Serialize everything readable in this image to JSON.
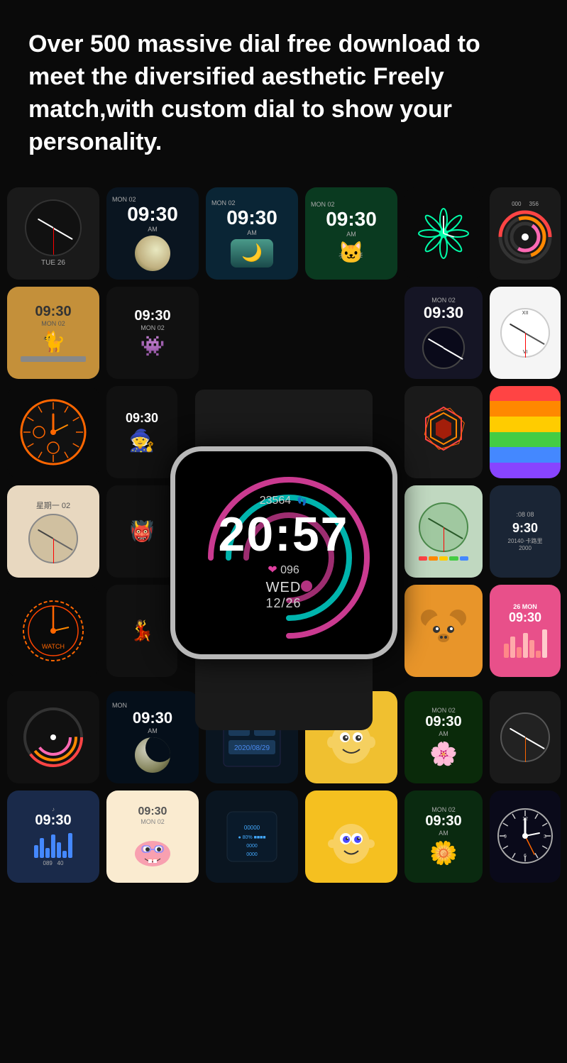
{
  "header": {
    "title": "Over 500 massive dial free download to meet the diversified aesthetic Freely match,with custom dial to show your personality."
  },
  "center_watch": {
    "steps": "23564",
    "time": "20:57",
    "heartrate": "096",
    "day": "WED",
    "date": "12/26"
  },
  "watch_faces": [
    {
      "id": 1,
      "type": "analog_red",
      "label": "TUE 26",
      "bg": "#1a1a1a"
    },
    {
      "id": 2,
      "type": "digital_dark",
      "time": "09:30",
      "sub": "AM",
      "date": "MON 02",
      "bg": "#0d1b2a"
    },
    {
      "id": 3,
      "type": "digital_teal",
      "time": "09:30",
      "sub": "AM",
      "date": "MON 02",
      "bg": "#1a3a4a"
    },
    {
      "id": 4,
      "type": "digital_green",
      "time": "09:30",
      "sub": "AM",
      "date": "MON 02",
      "bg": "#0a3a2a"
    },
    {
      "id": 5,
      "type": "neon_clock",
      "label": "",
      "bg": "#111"
    },
    {
      "id": 6,
      "type": "sports_tri",
      "label": "000 356",
      "bg": "#1a1a1a"
    },
    {
      "id": 7,
      "type": "cat_face",
      "time": "09:30",
      "date": "MON 02",
      "bg": "#d4a460"
    },
    {
      "id": 8,
      "type": "anime_dark",
      "time": "09:30",
      "date": "MON 02",
      "bg": "#111"
    },
    {
      "id": 9,
      "type": "digital_blue2",
      "time": "09:30",
      "date": "MON 02",
      "bg": "#1a1a2a"
    },
    {
      "id": 10,
      "type": "analog_white",
      "bg": "#fff"
    },
    {
      "id": 11,
      "type": "orange_analog",
      "bg": "#1a1a1a"
    },
    {
      "id": 12,
      "type": "anime2",
      "time": "09:30",
      "bg": "#111"
    },
    {
      "id": 13,
      "type": "hex_color",
      "bg": "#222"
    },
    {
      "id": 14,
      "type": "stripes_color",
      "bg": "#f5a623"
    },
    {
      "id": 15,
      "type": "chinese_digital",
      "label": "星期一 02",
      "bg": "#f0e8d0"
    },
    {
      "id": 16,
      "type": "anime3",
      "bg": "#111"
    },
    {
      "id": 17,
      "type": "green_analog",
      "bg": "#d4e8d0"
    },
    {
      "id": 18,
      "type": "digital_cool",
      "time": "09:30",
      "bg": "#2a3a4a"
    },
    {
      "id": 19,
      "type": "sci_fi",
      "bg": "#1a1a1a"
    },
    {
      "id": 20,
      "type": "anime4",
      "bg": "#111"
    },
    {
      "id": 21,
      "type": "bear_face",
      "bg": "#f5a623"
    },
    {
      "id": 22,
      "type": "pink_bars",
      "time": "09:30",
      "date": "26 MON",
      "bg": "#ff69b4"
    },
    {
      "id": 23,
      "type": "sports2",
      "bg": "#111"
    },
    {
      "id": 24,
      "type": "moon_dark",
      "bg": "#0d1b2a"
    },
    {
      "id": 25,
      "type": "dark_device",
      "bg": "#1a2a3a"
    },
    {
      "id": 26,
      "type": "simpson",
      "bg": "#f5a623"
    },
    {
      "id": 27,
      "type": "flower",
      "time": "09:30",
      "date": "MON 02",
      "bg": "#0a3a2a"
    },
    {
      "id": 28,
      "type": "analog3",
      "bg": "#1a1a1a"
    },
    {
      "id": 29,
      "type": "sports3",
      "time": "09:30",
      "bg": "#2a3a5a"
    },
    {
      "id": 30,
      "type": "patrick",
      "time": "09:30",
      "date": "MON 02",
      "bg": "#f5e6c8"
    },
    {
      "id": 31,
      "type": "smart_device",
      "bg": "#1a2a3a"
    },
    {
      "id": 32,
      "type": "bart_simpson",
      "bg": "#f0c030"
    },
    {
      "id": 33,
      "type": "flower2",
      "time": "09:30",
      "date": "MON 02",
      "bg": "#0a3a2a"
    },
    {
      "id": 34,
      "type": "analog4",
      "bg": "#1a1a3a"
    }
  ]
}
